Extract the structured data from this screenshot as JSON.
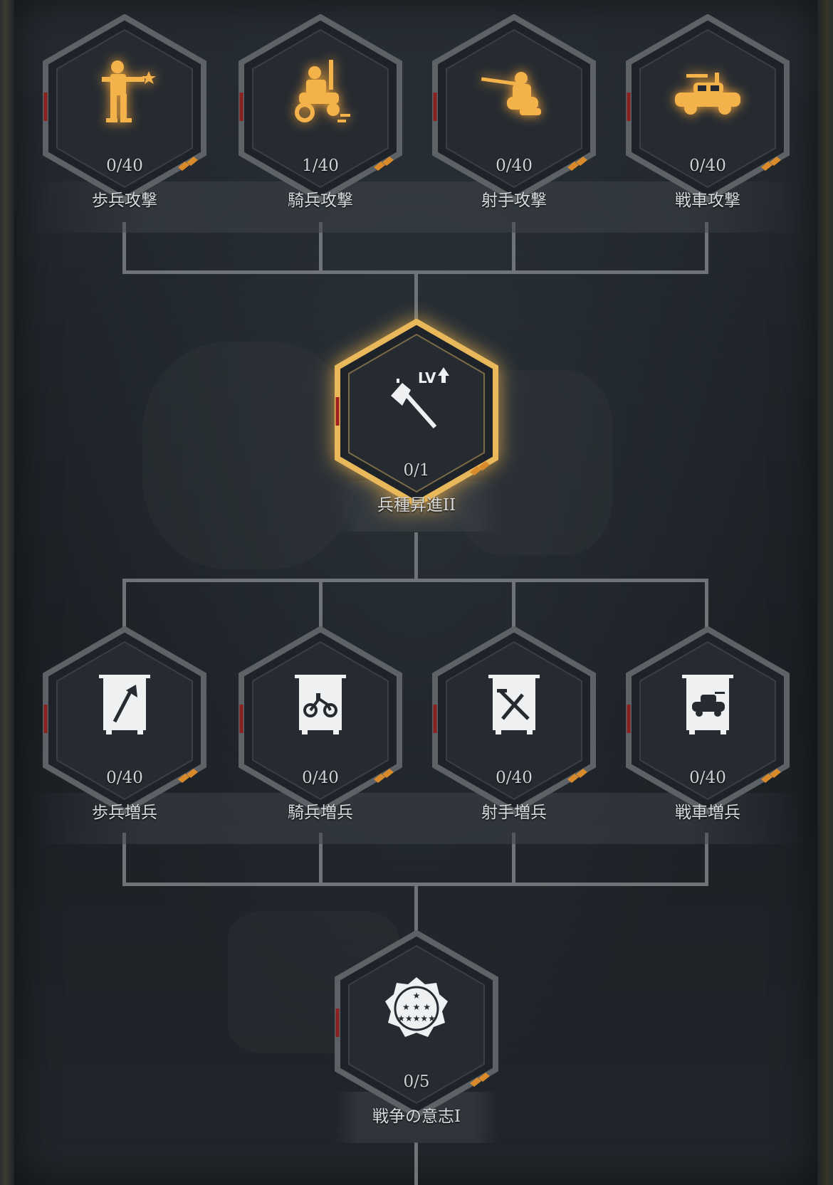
{
  "colors": {
    "gold": "#f3b24a",
    "gold_glow": "#ffcf6a",
    "white_icon": "#eef0f2",
    "frame": "#6b7075",
    "accent_red": "#a02020",
    "tick_orange": "#d98a2a"
  },
  "tiers": [
    {
      "nodes": [
        {
          "name": "歩兵攻撃",
          "progress": "0/40",
          "icon": "infantry-soldier-icon"
        },
        {
          "name": "騎兵攻撃",
          "progress": "1/40",
          "icon": "cavalry-rider-icon"
        },
        {
          "name": "射手攻撃",
          "progress": "0/40",
          "icon": "marksman-icon"
        },
        {
          "name": "戦車攻撃",
          "progress": "0/40",
          "icon": "tank-vehicle-icon"
        }
      ]
    },
    {
      "nodes": [
        {
          "name": "兵種昇進II",
          "progress": "0/1",
          "icon": "axe-level-up-icon",
          "icon_text": "LV"
        }
      ]
    },
    {
      "nodes": [
        {
          "name": "歩兵増兵",
          "progress": "0/40",
          "icon": "infantry-banner-icon"
        },
        {
          "name": "騎兵増兵",
          "progress": "0/40",
          "icon": "cavalry-banner-icon"
        },
        {
          "name": "射手増兵",
          "progress": "0/40",
          "icon": "marksman-banner-icon"
        },
        {
          "name": "戦車増兵",
          "progress": "0/40",
          "icon": "tank-banner-icon"
        }
      ]
    },
    {
      "nodes": [
        {
          "name": "戦争の意志I",
          "progress": "0/5",
          "icon": "war-will-stars-icon"
        }
      ]
    }
  ]
}
